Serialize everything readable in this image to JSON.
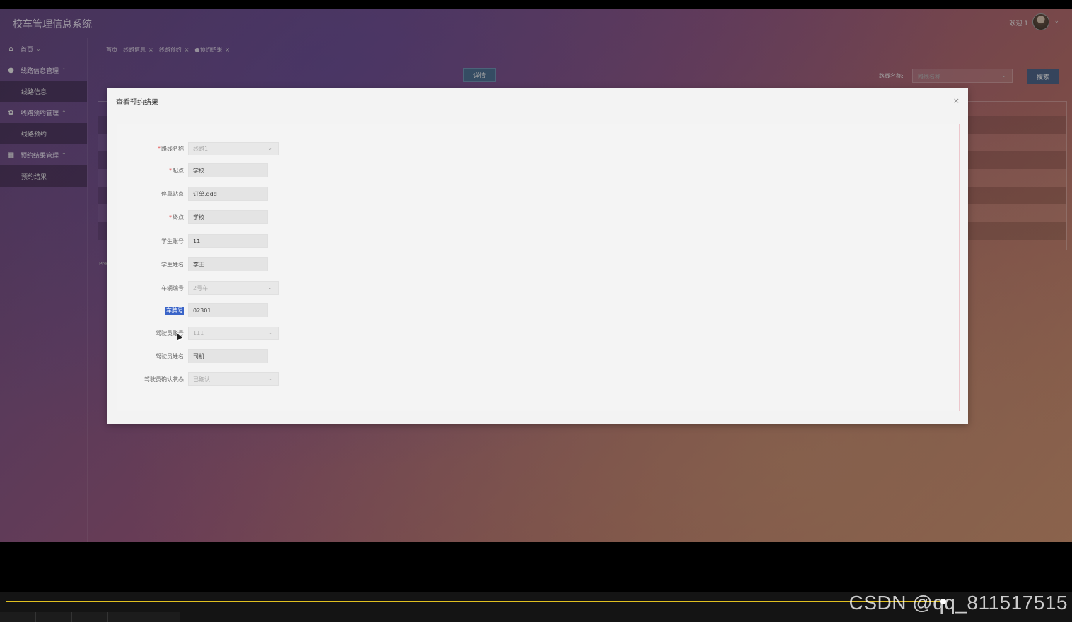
{
  "app": {
    "title": "校车管理信息系统",
    "welcome": "欢迎 1"
  },
  "sidebar": {
    "items": [
      {
        "label": "首页",
        "icon": "home-icon",
        "caret": "⌄"
      },
      {
        "label": "线路信息管理",
        "icon": "check-circle-icon",
        "caret": "⌃",
        "sub": "线路信息"
      },
      {
        "label": "线路预约管理",
        "icon": "gear-icon",
        "caret": "⌃",
        "sub": "线路预约"
      },
      {
        "label": "预约结果管理",
        "icon": "table-icon",
        "caret": "⌃",
        "sub": "预约结果"
      }
    ]
  },
  "tabs": [
    {
      "label": "首页"
    },
    {
      "label": "线路信息",
      "close": "×"
    },
    {
      "label": "线路预约",
      "close": "×"
    },
    {
      "label": "●预约结果",
      "close": "×"
    }
  ],
  "toolbar": {
    "detail_label": "详情",
    "search_label": "路线名称:",
    "search_placeholder": "路线名称",
    "search_button": "搜索"
  },
  "pager": {
    "text": "Pre"
  },
  "modal": {
    "title": "查看预约结果",
    "close": "×",
    "fields": [
      {
        "label": "路线名称",
        "required": true,
        "type": "select",
        "value": "线路1"
      },
      {
        "label": "起点",
        "required": true,
        "type": "input",
        "value": "学校"
      },
      {
        "label": "停靠站点",
        "required": false,
        "type": "input",
        "value": "订单,ddd"
      },
      {
        "label": "终点",
        "required": true,
        "type": "input",
        "value": "学校"
      },
      {
        "label": "学生账号",
        "required": false,
        "type": "input",
        "value": "11"
      },
      {
        "label": "学生姓名",
        "required": false,
        "type": "input",
        "value": "李王"
      },
      {
        "label": "车辆编号",
        "required": false,
        "type": "select",
        "value": "2号车"
      },
      {
        "label": "车牌号",
        "required": false,
        "type": "input",
        "value": "02301",
        "highlighted": true
      },
      {
        "label": "驾驶员账号",
        "required": false,
        "type": "select",
        "value": "111"
      },
      {
        "label": "驾驶员姓名",
        "required": false,
        "type": "input",
        "value": "司机"
      },
      {
        "label": "驾驶员确认状态",
        "required": false,
        "type": "select",
        "value": "已确认"
      }
    ]
  },
  "video": {
    "progress": 0.884,
    "watermark": "CSDN @qq_811517515"
  },
  "colors": {
    "progress": "#e0c020",
    "required_mark": "#e04040",
    "selection": "#3a64c8"
  }
}
